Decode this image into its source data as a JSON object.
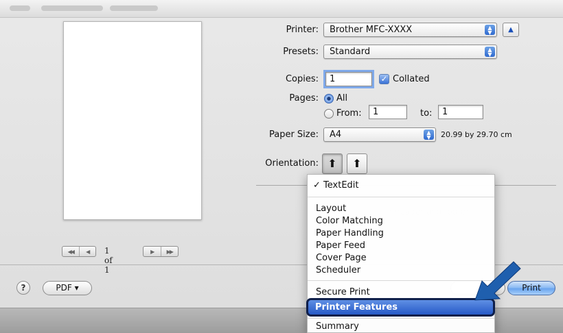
{
  "printer": {
    "label": "Printer:",
    "value": "Brother MFC-XXXX"
  },
  "presets": {
    "label": "Presets:",
    "value": "Standard"
  },
  "copies": {
    "label": "Copies:",
    "value": "1",
    "collated_label": "Collated"
  },
  "pages": {
    "label": "Pages:",
    "all_label": "All",
    "from_label": "From:",
    "from_value": "1",
    "to_label": "to:",
    "to_value": "1"
  },
  "paper_size": {
    "label": "Paper Size:",
    "value": "A4",
    "dimensions": "20.99 by 29.70 cm"
  },
  "orientation": {
    "label": "Orientation:"
  },
  "pager": {
    "text": "1 of 1"
  },
  "buttons": {
    "pdf": "PDF ▾",
    "print": "Print",
    "help": "?"
  },
  "menu": {
    "checked_item": "✓ TextEdit",
    "items": [
      "Layout",
      "Color Matching",
      "Paper Handling",
      "Paper Feed",
      "Cover Page",
      "Scheduler",
      "Secure Print"
    ],
    "highlighted": "Printer Features",
    "after": [
      "Summary"
    ]
  },
  "colors": {
    "highlight": "#2f63d0",
    "ring": "#0f1f4a",
    "arrow": "#1f5fae"
  }
}
